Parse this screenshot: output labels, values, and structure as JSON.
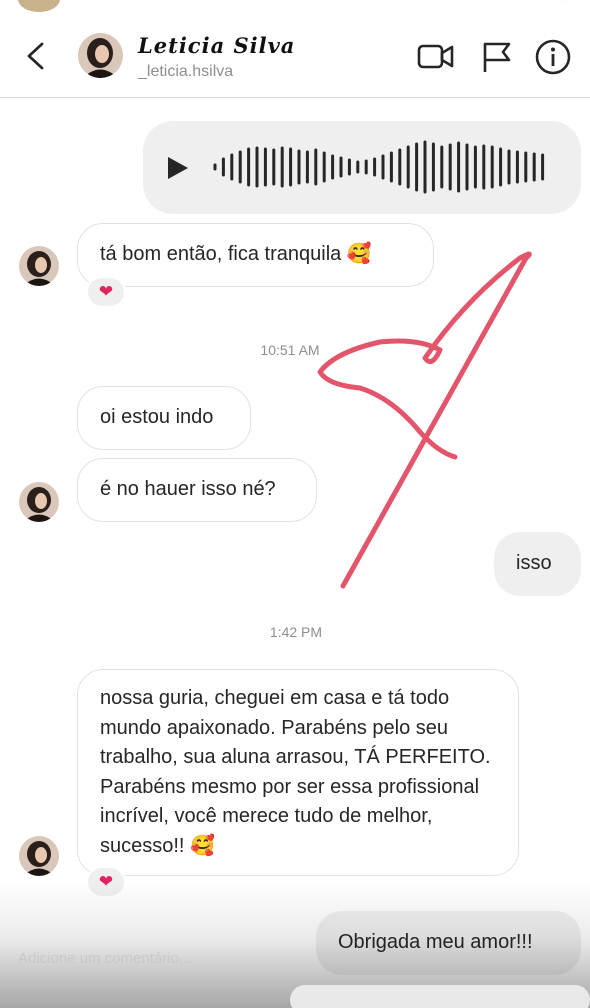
{
  "header": {
    "name": "Leticia Silva",
    "username": "_leticia.hsilva"
  },
  "messages": {
    "received_1": "tá bom então, fica tranquila 🥰",
    "reaction_1": "❤",
    "time_1": "10:51 AM",
    "received_2": "oi estou indo",
    "received_3": "é no hauer isso né?",
    "sent_1": "isso",
    "time_2": "1:42 PM",
    "received_4": "nossa guria, cheguei em casa e tá todo mundo apaixonado. Parabéns pelo seu trabalho, sua aluna arrasou, TÁ PERFEITO. Parabéns mesmo por ser essa profissional incrível, você merece tudo de melhor, sucesso!! 🥰",
    "reaction_2": "❤",
    "sent_2": "Obrigada meu amor!!!"
  },
  "footer": {
    "comment_placeholder": "Adicione um comentário..."
  },
  "colors": {
    "annotation_red": "#e0465d",
    "heart_red": "#e0245e",
    "bubble_out": "#efefef",
    "border": "#e2e2e2"
  },
  "icons": [
    "back-icon",
    "video-camera-icon",
    "flag-icon",
    "info-icon",
    "play-icon",
    "heart-icon"
  ]
}
